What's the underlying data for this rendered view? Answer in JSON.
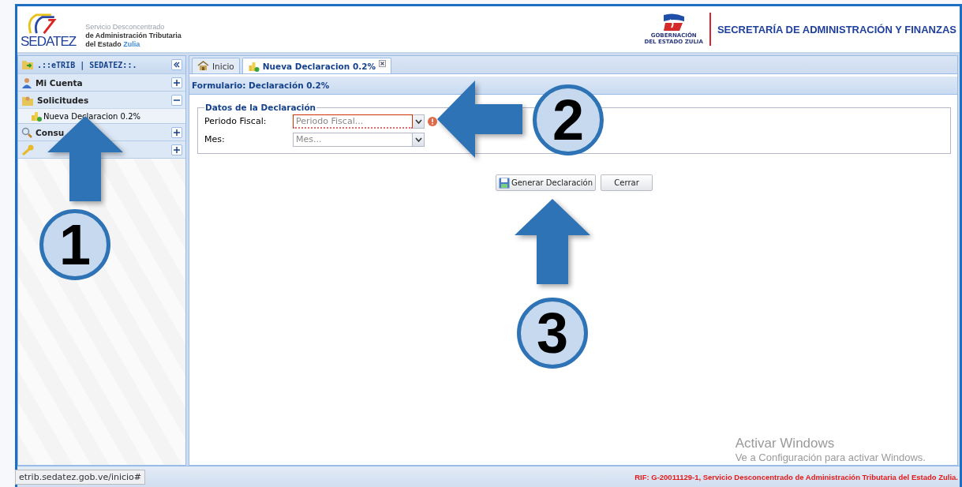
{
  "header": {
    "logo_text": "SEDATEZ",
    "org_lines": [
      "Servicio Desconcentrado",
      "de Administración Tributaria",
      "del Estado "
    ],
    "org_highlight": "Zulia",
    "gov_logo_lines": [
      "GOBERNACIÓN",
      "DEL ESTADO ZULIA"
    ],
    "secretariat": "SECRETARÍA DE ADMINISTRACIÓN Y FINANZAS"
  },
  "sidebar": {
    "title": ".::eTRIB | SEDATEZ::.",
    "sections": [
      {
        "kind": "user",
        "label": "Mi Cuenta",
        "expanded": false
      },
      {
        "kind": "folder",
        "label": "Solicitudes",
        "expanded": true,
        "children": [
          {
            "label": "Nueva Declaracion 0.2%"
          }
        ]
      },
      {
        "kind": "search",
        "label": "Consu",
        "expanded": false
      },
      {
        "kind": "key",
        "expanded": false
      }
    ]
  },
  "tabs": [
    {
      "kind": "home",
      "label": "Inicio",
      "selected": false,
      "closable": false
    },
    {
      "kind": "coins",
      "label": "Nueva Declaracion 0.2%",
      "selected": true,
      "closable": true
    }
  ],
  "panel": {
    "title": "Formulario: Declaración 0.2%",
    "fieldset": "Datos de la Declaración",
    "fields": [
      {
        "label": "Periodo Fiscal:",
        "placeholder": "Periodo Fiscal...",
        "invalid": true
      },
      {
        "label": "Mes:",
        "placeholder": "Mes...",
        "invalid": false
      }
    ],
    "buttons": [
      {
        "kind": "save",
        "label": "Generar Declaración"
      },
      {
        "kind": "plain",
        "label": "Cerrar"
      }
    ]
  },
  "watermark": {
    "title": "Activar Windows",
    "subtitle": "Ve a Configuración para activar Windows."
  },
  "status_bar": {
    "url": "etrib.sedatez.gob.ve/inicio#",
    "notice": "RIF: G-20011129-1, Servicio Desconcentrado de Administración Tributaria del Estado Zulia."
  },
  "annotations": [
    {
      "number": "1",
      "kind": "up"
    },
    {
      "number": "2",
      "kind": "left"
    },
    {
      "number": "3",
      "kind": "up"
    }
  ]
}
